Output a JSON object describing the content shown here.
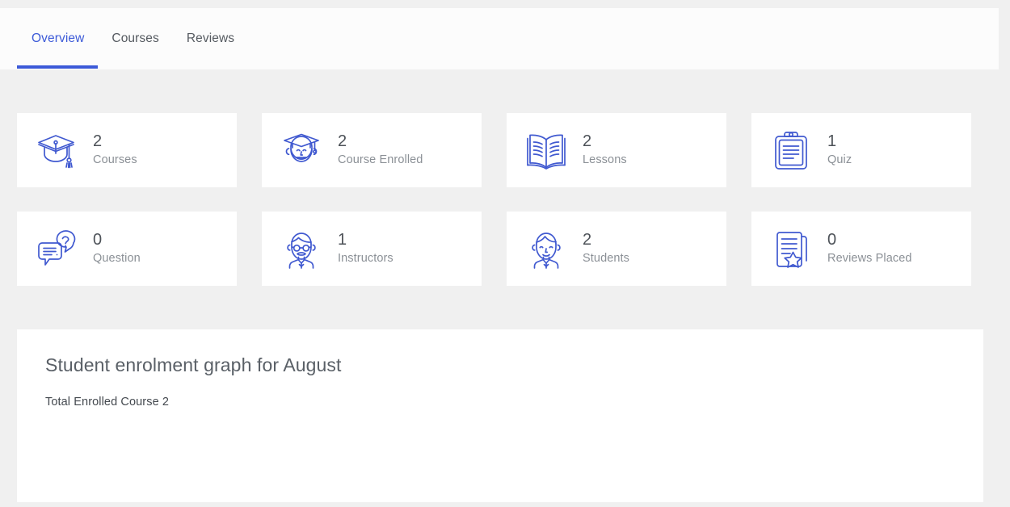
{
  "theme": {
    "page_background": "#f0f0f0",
    "card_background": "#ffffff",
    "tabbar_background": "#fcfcfc",
    "accent_blue": "#3c5ad8",
    "icon_blue": "#4059d0",
    "value_text": "#4d5258",
    "label_text": "#8b9096"
  },
  "tabs": [
    {
      "label": "Overview",
      "active": true,
      "icon": "overview-tab"
    },
    {
      "label": "Courses",
      "active": false,
      "icon": "courses-tab"
    },
    {
      "label": "Reviews",
      "active": false,
      "icon": "reviews-tab"
    }
  ],
  "stats": [
    {
      "value": "2",
      "label": "Courses",
      "icon": "graduation-cap-icon"
    },
    {
      "value": "2",
      "label": "Course Enrolled",
      "icon": "graduate-student-icon"
    },
    {
      "value": "2",
      "label": "Lessons",
      "icon": "open-book-icon"
    },
    {
      "value": "1",
      "label": "Quiz",
      "icon": "clipboard-icon"
    },
    {
      "value": "0",
      "label": "Question",
      "icon": "question-chat-icon"
    },
    {
      "value": "1",
      "label": "Instructors",
      "icon": "instructor-icon"
    },
    {
      "value": "2",
      "label": "Students",
      "icon": "student-icon"
    },
    {
      "value": "0",
      "label": "Reviews Placed",
      "icon": "review-document-star-icon"
    }
  ],
  "graph": {
    "title": "Student enrolment graph for August",
    "subtitle": "Total Enrolled Course 2"
  },
  "chart_data": {
    "type": "line",
    "title": "Student enrolment graph for August",
    "annotations": [
      "Total Enrolled Course 2"
    ],
    "x": [],
    "values": [],
    "xlabel": "",
    "ylabel": "",
    "grid": false,
    "legend": "none",
    "note": "Plot area rendered empty in screenshot"
  }
}
